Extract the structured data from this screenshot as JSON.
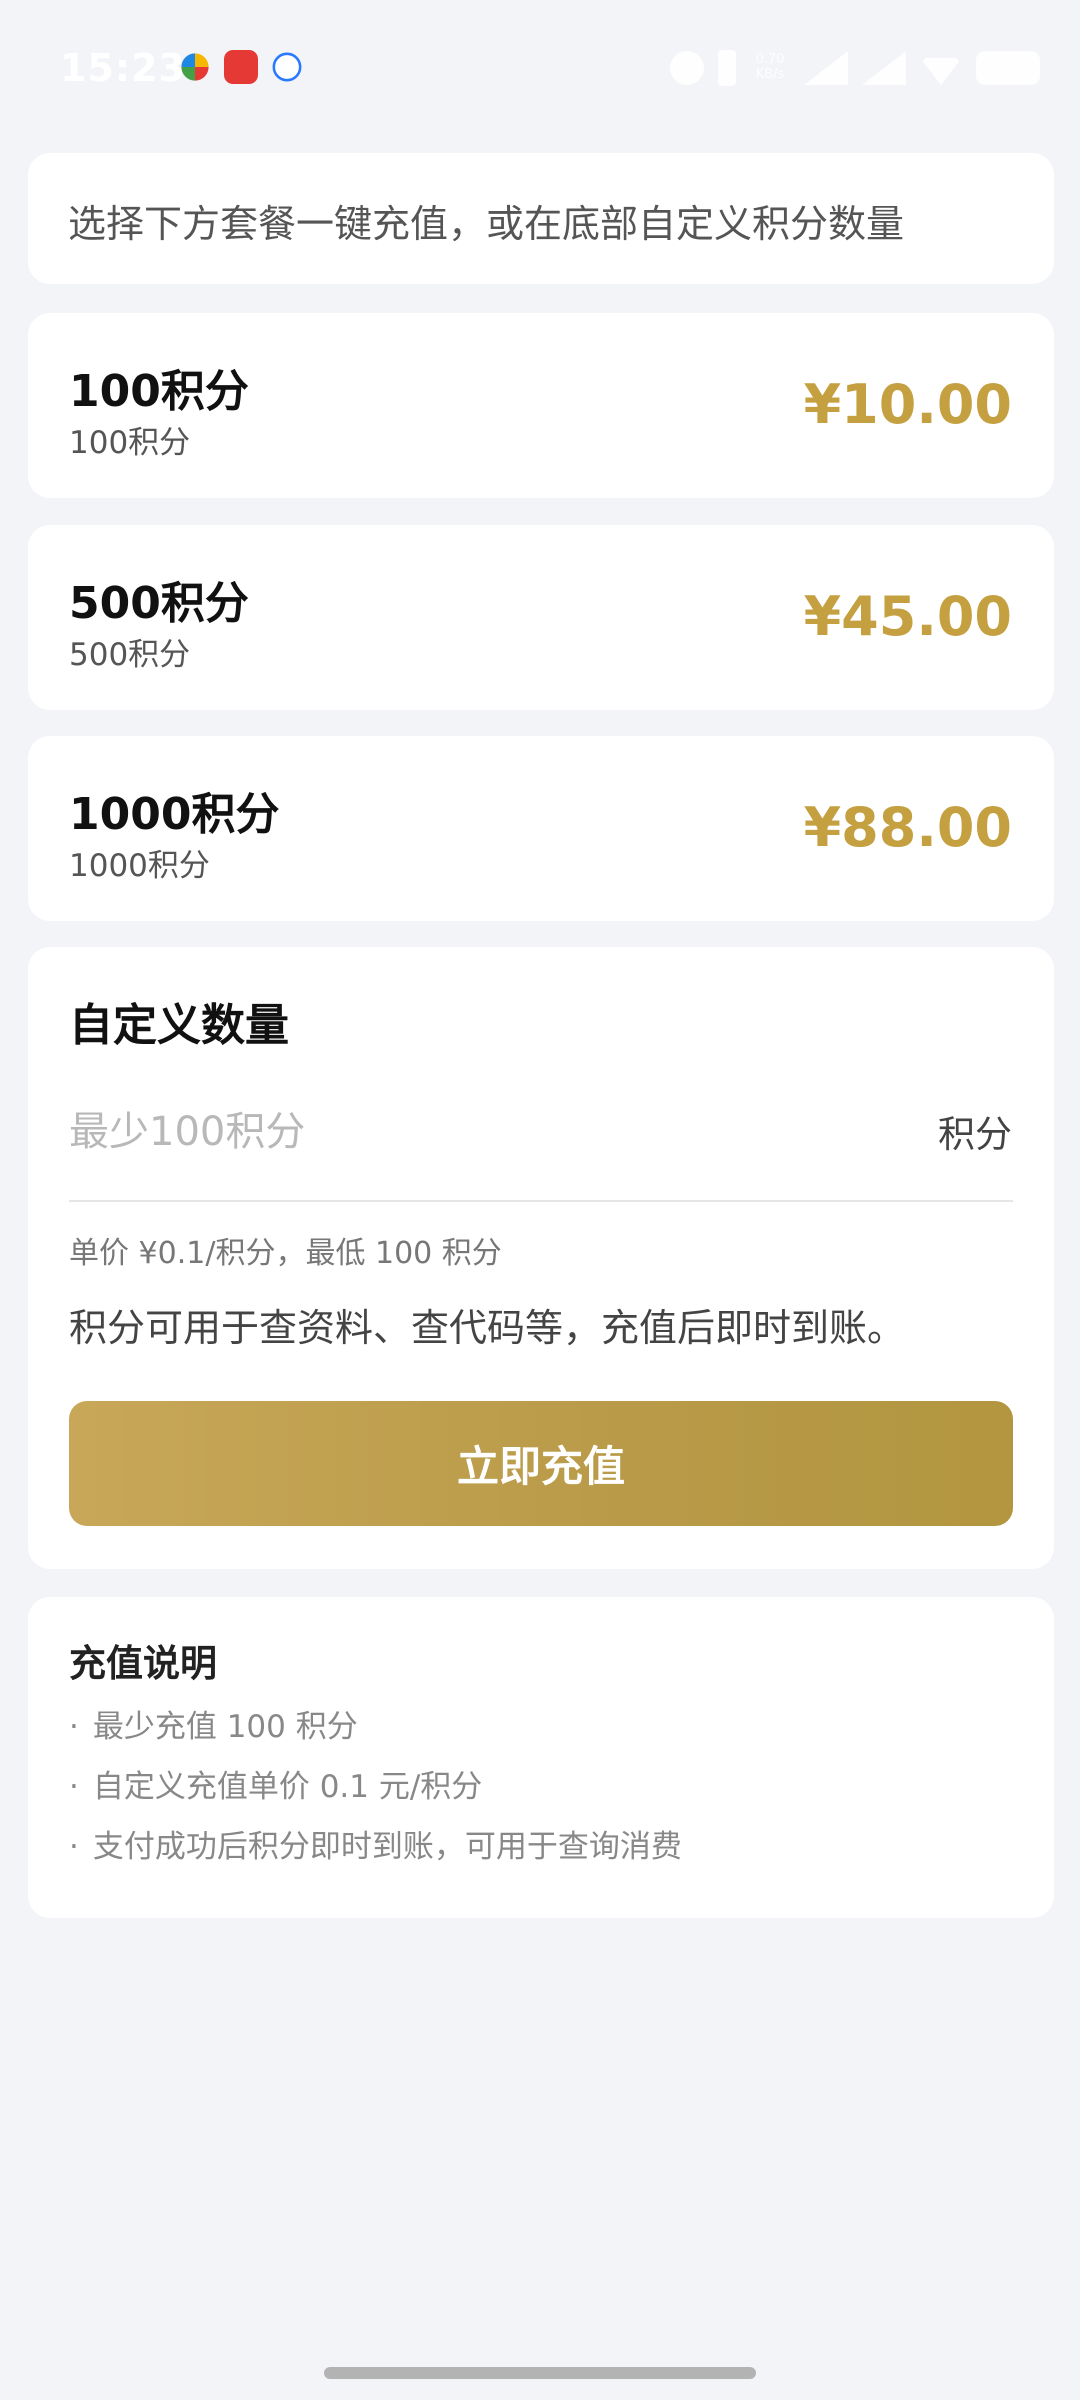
{
  "status_bar": {
    "time": "15:23",
    "net_speed": "0.70\nKB/s"
  },
  "intro": {
    "text": "选择下方套餐一键充值，或在底部自定义积分数量"
  },
  "packages": [
    {
      "title": "100积分",
      "subtitle": "100积分",
      "price": "¥10.00"
    },
    {
      "title": "500积分",
      "subtitle": "500积分",
      "price": "¥45.00"
    },
    {
      "title": "1000积分",
      "subtitle": "1000积分",
      "price": "¥88.00"
    }
  ],
  "custom": {
    "title": "自定义数量",
    "input_placeholder": "最少100积分",
    "input_value": "",
    "unit": "积分",
    "hint": "单价 ¥0.1/积分，最低 100 积分",
    "description": "积分可用于查资料、查代码等，充值后即时到账。",
    "button_label": "立即充值"
  },
  "notes": {
    "title": "充值说明",
    "items": [
      "最少充值 100 积分",
      "自定义充值单价 0.1 元/积分",
      "支付成功后积分即时到账，可用于查询消费"
    ],
    "bullet": "·"
  },
  "colors": {
    "accent_gold": "#c5a040",
    "background": "#f3f4f8",
    "card": "#ffffff"
  },
  "icons": [
    "alarm-icon",
    "bluetooth-icon",
    "signal-icon",
    "wifi-icon",
    "battery-icon"
  ]
}
